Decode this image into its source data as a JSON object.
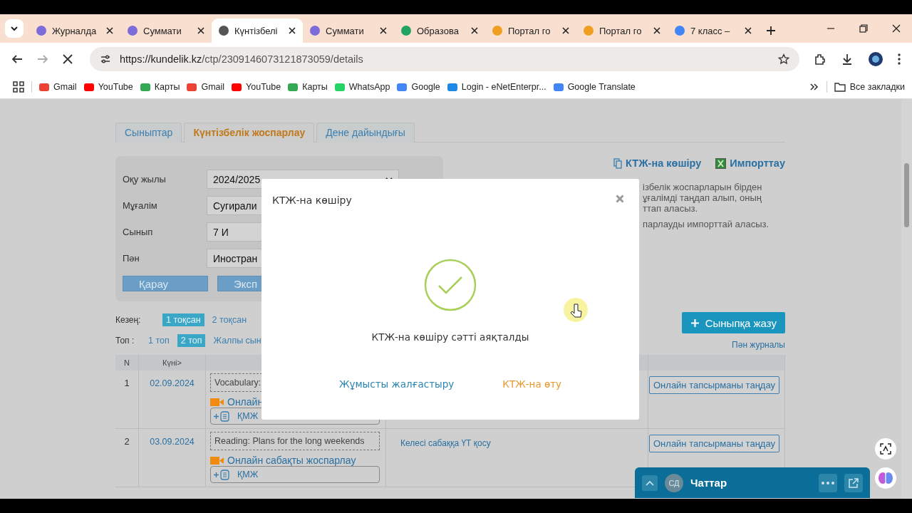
{
  "browser": {
    "tabs": [
      {
        "title": "Журналда",
        "selected": false,
        "color": "#7b6cd9"
      },
      {
        "title": "Суммати",
        "selected": false,
        "color": "#7b6cd9"
      },
      {
        "title": "Күнтізбелі",
        "selected": true,
        "color": "#555555"
      },
      {
        "title": "Суммати",
        "selected": false,
        "color": "#7b6cd9"
      },
      {
        "title": "Образова",
        "selected": false,
        "color": "#1fa463"
      },
      {
        "title": "Портал го",
        "selected": false,
        "color": "#f0a020"
      },
      {
        "title": "Портал го",
        "selected": false,
        "color": "#f0a020"
      },
      {
        "title": "7 класс –",
        "selected": false,
        "color": "#4285f4"
      }
    ],
    "url_host": "https://kundelik.kz",
    "url_path": "/ctp/2309146073121873059/details",
    "bookmarks": [
      {
        "label": "Gmail",
        "color": "#ea4335"
      },
      {
        "label": "YouTube",
        "color": "#ff0000"
      },
      {
        "label": "Карты",
        "color": "#34a853"
      },
      {
        "label": "Gmail",
        "color": "#ea4335"
      },
      {
        "label": "YouTube",
        "color": "#ff0000"
      },
      {
        "label": "Карты",
        "color": "#34a853"
      },
      {
        "label": "WhatsApp",
        "color": "#25d366"
      },
      {
        "label": "Google",
        "color": "#4285f4"
      },
      {
        "label": "Login - eNetEnterpr...",
        "color": "#1e88e5"
      },
      {
        "label": "Google Translate",
        "color": "#4285f4"
      }
    ],
    "all_bookmarks": "Все закладки"
  },
  "page": {
    "section_tabs": [
      {
        "label": "Сыныптар",
        "selected": false
      },
      {
        "label": "Күнтізбелік жоспарлау",
        "selected": true
      },
      {
        "label": "Дене дайындығы",
        "selected": false
      }
    ],
    "filters": [
      {
        "label": "Оқу жылы",
        "value": "2024/2025",
        "caret": true
      },
      {
        "label": "Мұғалім",
        "value": "Сугирали"
      },
      {
        "label": "Сынып",
        "value": "7 И"
      },
      {
        "label": "Пән",
        "value": "Иностран"
      }
    ],
    "panel_buttons": [
      "Қарау",
      "Эксп"
    ],
    "copy_link": "КТЖ-на көшіру",
    "import_link": "Импорттау",
    "description": [
      "ізбелік жоспарларын бірден",
      "ұғалімді таңдап алып, оның",
      "ттап аласыз.",
      "парлауды импорттай аласыз."
    ],
    "period": {
      "label": "Кезең:",
      "options": [
        {
          "label": "1 тоқсан",
          "selected": true
        },
        {
          "label": "2 тоқсан",
          "selected": false
        }
      ]
    },
    "group": {
      "label": "Топ :",
      "options": [
        {
          "label": "1 топ",
          "selected": false
        },
        {
          "label": "2 топ",
          "selected": true
        },
        {
          "label": "Жалпы сын",
          "selected": false
        }
      ]
    },
    "add_button": "Сыныпқа жазу",
    "journal_link": "Пән журналы",
    "table": {
      "columns": [
        "N",
        "Күні>"
      ],
      "rows": [
        {
          "n": "1",
          "date": "02.09.2024",
          "topic": "Vocabulary:",
          "online": "Онлайн",
          "plan": "ҚМЖ",
          "task_button": "Онлайн тапсырманы таңдау"
        },
        {
          "n": "2",
          "date": "03.09.2024",
          "topic": "Reading: Plans for the long weekends",
          "online": "Онлайн сабақты жоспарлау",
          "plan": "ҚМЖ",
          "homework": "Келесі сабаққа ҮТ қосу",
          "task_button": "Онлайн тапсырманы таңдау"
        }
      ]
    }
  },
  "modal": {
    "title": "КТЖ-на көшіру",
    "message": "КТЖ-на көшіру сәтті аяқталды",
    "buttons": [
      {
        "label": "Жұмысты жалғастыру",
        "kind": "primary"
      },
      {
        "label": "КТЖ-на өту",
        "kind": "secondary"
      }
    ]
  },
  "chat": {
    "avatar": "СД",
    "title": "Чаттар"
  }
}
